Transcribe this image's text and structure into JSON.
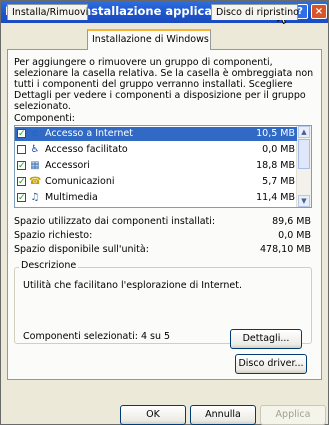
{
  "window": {
    "title": "Proprietà - Installazione applicazioni",
    "help_glyph": "?",
    "close_glyph": "×"
  },
  "tabs": [
    "Installa/Rimuovi",
    "Installazione di Windows",
    "Disco di ripristino"
  ],
  "description": "Per aggiungere o rimuovere un gruppo di componenti, selezionare la casella relativa. Se la casella è ombreggiata non tutti i componenti del gruppo verranno installati. Scegliere Dettagli per vedere i componenti a disposizione per il gruppo selezionato.",
  "components_label": "Componenti:",
  "components": [
    {
      "name": "Accesso a Internet",
      "size": "10,5 MB",
      "checked": true,
      "icon": "internet-explorer-icon",
      "glyph": "e",
      "glyph_color": "#1e62d0"
    },
    {
      "name": "Accesso facilitato",
      "size": "0,0 MB",
      "checked": false,
      "icon": "accessibility-icon",
      "glyph": "♿",
      "glyph_color": "#1d4fa8"
    },
    {
      "name": "Accessori",
      "size": "18,8 MB",
      "checked": true,
      "icon": "accessories-icon",
      "glyph": "▦",
      "glyph_color": "#3f6fb3"
    },
    {
      "name": "Comunicazioni",
      "size": "5,7 MB",
      "checked": true,
      "icon": "communications-icon",
      "glyph": "☎",
      "glyph_color": "#c6a200"
    },
    {
      "name": "Multimedia",
      "size": "11,4 MB",
      "checked": true,
      "icon": "multimedia-icon",
      "glyph": "♫",
      "glyph_color": "#2d5c8e"
    }
  ],
  "stats": [
    {
      "label": "Spazio utilizzato dai componenti installati:",
      "value": "89,6 MB"
    },
    {
      "label": "Spazio richiesto:",
      "value": "0,0 MB"
    },
    {
      "label": "Spazio disponibile sull'unità:",
      "value": "478,10 MB"
    }
  ],
  "group": {
    "legend": "Descrizione",
    "text": "Utilità che facilitano l'esplorazione di Internet.",
    "selected": "Componenti selezionati: 4 su 5",
    "details_button": "Dettagli..."
  },
  "disk_button": "Disco driver...",
  "footer": {
    "ok": "OK",
    "cancel": "Annulla",
    "apply": "Applica"
  },
  "colors": {
    "title_bar": "#1d52c8",
    "selection": "#316ac5",
    "active_tab_accent": "#f9b136"
  }
}
